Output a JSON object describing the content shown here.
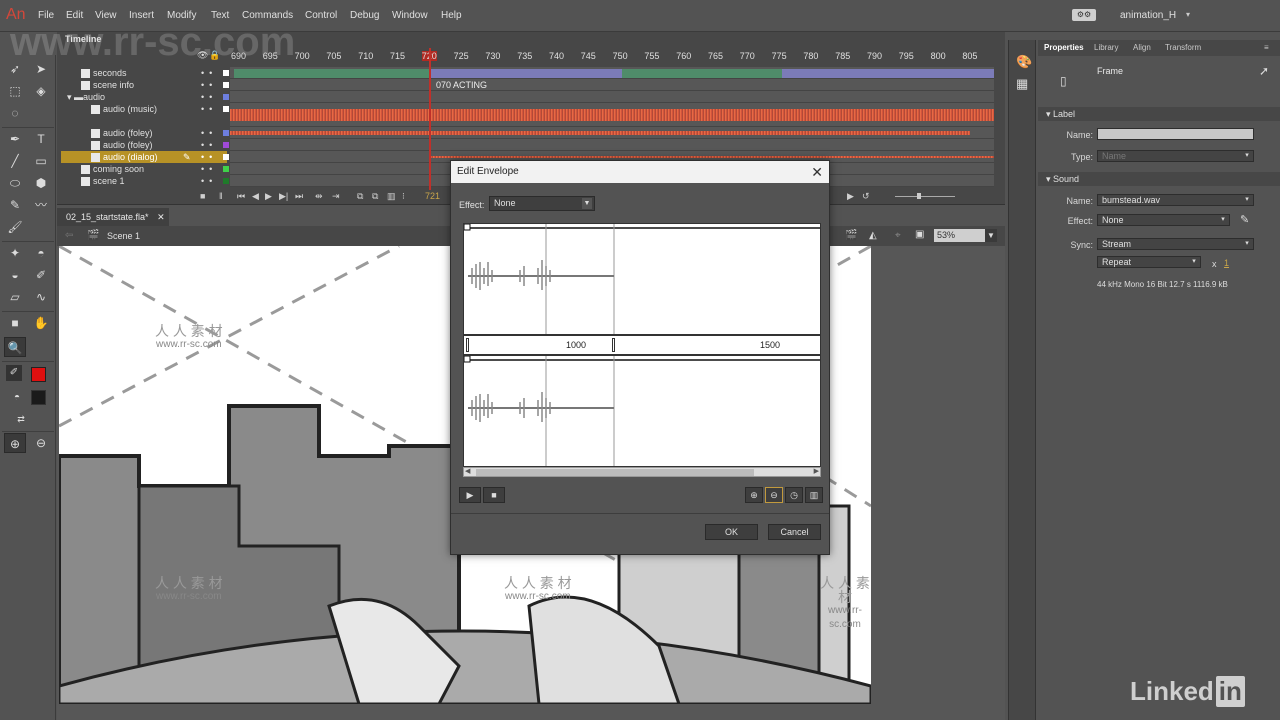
{
  "app": {
    "logo": "An",
    "workspace_name": "animation_H"
  },
  "menu": [
    "File",
    "Edit",
    "View",
    "Insert",
    "Modify",
    "Text",
    "Commands",
    "Control",
    "Debug",
    "Window",
    "Help"
  ],
  "timeline": {
    "title": "Timeline",
    "ruler": [
      "690",
      "695",
      "700",
      "705",
      "710",
      "715",
      "720",
      "725",
      "730",
      "735",
      "740",
      "745",
      "750",
      "755",
      "760",
      "765",
      "770",
      "775",
      "780",
      "785",
      "790",
      "795",
      "800",
      "805"
    ],
    "current_frame_marker": "720",
    "layers": [
      {
        "name": "seconds",
        "indent": 1,
        "color": "#ffffff",
        "selected": false
      },
      {
        "name": "scene info",
        "indent": 1,
        "color": "#ffffff",
        "selected": false
      },
      {
        "name": "audio",
        "indent": 0,
        "folder": true,
        "color": "#6d7fe0",
        "selected": false
      },
      {
        "name": "audio (music)",
        "indent": 2,
        "color": "#ffffff",
        "selected": false
      },
      {
        "name": "audio (foley)",
        "indent": 2,
        "color": "#6d7fe0",
        "selected": false
      },
      {
        "name": "audio (foley)",
        "indent": 2,
        "color": "#a04ad8",
        "selected": false
      },
      {
        "name": "audio (dialog)",
        "indent": 2,
        "color": "#ffffff",
        "selected": true
      },
      {
        "name": "coming soon",
        "indent": 1,
        "color": "#3fd24a",
        "selected": false
      },
      {
        "name": "scene 1",
        "indent": 1,
        "color": "#1f7a2a",
        "selected": false
      }
    ],
    "frame_label": "070 ACTING",
    "frame_counter": "721"
  },
  "document": {
    "tab": "02_15_startstate.fla*",
    "scene": "Scene 1",
    "zoom": "53%"
  },
  "dialog": {
    "title": "Edit Envelope",
    "effect_label": "Effect:",
    "effect_value": "None",
    "ruler_labels": [
      "1000",
      "1500"
    ],
    "ok": "OK",
    "cancel": "Cancel"
  },
  "properties": {
    "tabs": [
      "Properties",
      "Library",
      "Align",
      "Transform"
    ],
    "type": "Frame",
    "label_section": "Label",
    "label_name_label": "Name:",
    "label_name_value": "",
    "label_type_label": "Type:",
    "label_type_value": "Name",
    "sound_section": "Sound",
    "sound_name_label": "Name:",
    "sound_name_value": "bumstead.wav",
    "effect_label": "Effect:",
    "effect_value": "None",
    "sync_label": "Sync:",
    "sync_value": "Stream",
    "repeat_value": "Repeat",
    "repeat_x": "x",
    "repeat_count": "1",
    "sound_info": "44 kHz Mono 16 Bit 12.7 s 1116.9 kB"
  },
  "watermark": {
    "cn": "人 人 素 材",
    "url": "www.rr-sc.com",
    "top": "www.rr-sc.com"
  },
  "branding": {
    "linkedin": "Linked",
    "in": "in"
  }
}
